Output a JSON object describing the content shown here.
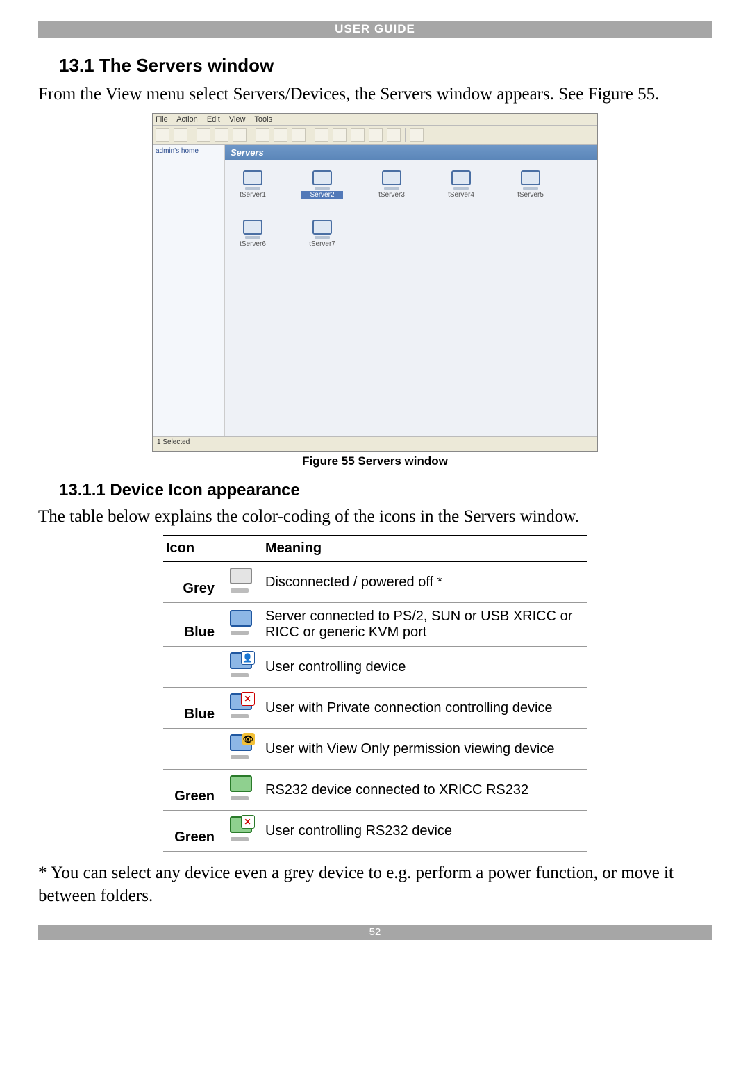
{
  "header_banner": "USER GUIDE",
  "section_title": "13.1 The Servers window",
  "intro_text": "From the View menu select Servers/Devices, the Servers window appears. See Figure 55.",
  "figure": {
    "menus": [
      "File",
      "Action",
      "Edit",
      "View",
      "Tools"
    ],
    "tree_root": "admin's home",
    "content_title": "Servers",
    "servers": [
      "tServer1",
      "Server2",
      "tServer3",
      "tServer4",
      "tServer5",
      "tServer6",
      "tServer7"
    ],
    "selected_index": 1,
    "statusbar": "1 Selected",
    "caption": "Figure 55 Servers window"
  },
  "subsection_title": "13.1.1 Device Icon appearance",
  "table_intro": "The table below explains the color-coding of the icons in the Servers window.",
  "table": {
    "headers": {
      "icon": "Icon",
      "meaning": "Meaning"
    },
    "rows": [
      {
        "label": "Grey",
        "icon_class": "c-grey",
        "overlay": "",
        "meaning": "Disconnected / powered off *"
      },
      {
        "label": "Blue",
        "icon_class": "c-blue",
        "overlay": "",
        "meaning": "Server connected to PS/2, SUN or USB XRICC or RICC or generic KVM port"
      },
      {
        "label": "",
        "icon_class": "c-blue",
        "overlay": "user",
        "meaning": "User controlling device"
      },
      {
        "label": "Blue",
        "icon_class": "c-blue",
        "overlay": "x",
        "meaning": "User with Private connection controlling device"
      },
      {
        "label": "",
        "icon_class": "c-blue",
        "overlay": "eye",
        "meaning": "User with View Only permission viewing device"
      },
      {
        "label": "Green",
        "icon_class": "c-green",
        "overlay": "",
        "meaning": "RS232 device connected to XRICC RS232"
      },
      {
        "label": "Green",
        "icon_class": "c-green",
        "overlay": "xg",
        "meaning": "User controlling RS232 device"
      }
    ]
  },
  "footnote": "* You can select any device even a grey device to e.g. perform a power function, or move it between folders.",
  "page_number": "52"
}
